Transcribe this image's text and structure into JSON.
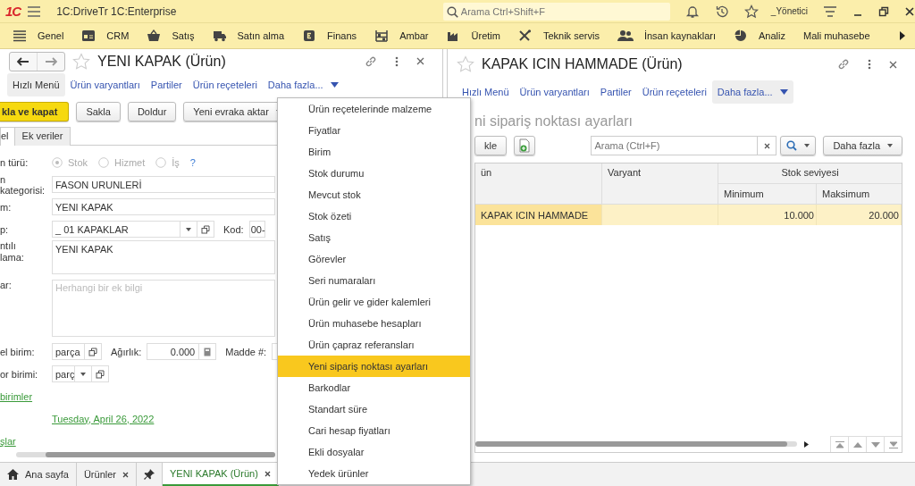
{
  "app": {
    "logo": "1C",
    "title": "1C:DriveTr 1C:Enterprise",
    "search_placeholder": "Arama Ctrl+Shift+F",
    "user": "_Yönetici"
  },
  "sections": [
    {
      "label": "Genel"
    },
    {
      "label": "CRM"
    },
    {
      "label": "Satış"
    },
    {
      "label": "Satın alma"
    },
    {
      "label": "Finans"
    },
    {
      "label": "Ambar"
    },
    {
      "label": "Üretim"
    },
    {
      "label": "Teknik servis"
    },
    {
      "label": "İnsan kaynakları"
    },
    {
      "label": "Analiz"
    },
    {
      "label": "Mali muhasebe"
    }
  ],
  "left_form": {
    "title": "YENI KAPAK (Ürün)",
    "nav": [
      {
        "label": "Hızlı Menü",
        "kind": "link",
        "selected": true
      },
      {
        "label": "Ürün varyantları",
        "kind": "link",
        "selected": false
      },
      {
        "label": "Partiler",
        "kind": "link",
        "selected": false
      },
      {
        "label": "Ürün reçeteleri",
        "kind": "link",
        "selected": false
      },
      {
        "label": "Daha fazla...",
        "kind": "more",
        "selected": false
      }
    ],
    "buttons": [
      {
        "label": "kla ve kapat",
        "kind": "primary"
      },
      {
        "label": "Sakla",
        "kind": "plain"
      },
      {
        "label": "Doldur",
        "kind": "plain"
      },
      {
        "label": "Yeni evraka aktar",
        "kind": "dropdown"
      }
    ],
    "tabs": [
      {
        "label": "el",
        "selected": true
      },
      {
        "label": "Ek veriler",
        "selected": false
      }
    ],
    "item_type": {
      "label": "n türü:",
      "help": "?",
      "options": [
        {
          "label": "Stok",
          "selected": true,
          "disabled": true
        },
        {
          "label": "Hizmet",
          "selected": false,
          "disabled": true
        },
        {
          "label": "İş",
          "selected": false,
          "disabled": true
        }
      ]
    },
    "category": {
      "label": "n kategorisi:",
      "value": "FASON URUNLERİ"
    },
    "name": {
      "label": "m:",
      "value": "YENI KAPAK"
    },
    "group": {
      "label": "p:",
      "value": "_ 01 KAPAKLAR",
      "code_label": "Kod:",
      "code_value": "00-"
    },
    "description": {
      "label": "ntılı\nlama:",
      "value": "YENI KAPAK"
    },
    "notes": {
      "label": "ar:",
      "placeholder": "Herhangi bir ek bilgi"
    },
    "unit": {
      "label": "el birim:",
      "value": "parça",
      "weight_label": "Ağırlık:",
      "weight_value": "0.000",
      "item_no_label": "Madde #:"
    },
    "report_unit": {
      "label": "or birimi:",
      "value": "parç"
    },
    "units_link": "birimler",
    "date_link": "Tuesday, April 26, 2022",
    "last_link": "şlar"
  },
  "menu": [
    {
      "label": "Ürün reçetelerinde malzeme",
      "selected": false
    },
    {
      "label": "Fiyatlar",
      "selected": false
    },
    {
      "label": "Birim",
      "selected": false
    },
    {
      "label": "Stok durumu",
      "selected": false
    },
    {
      "label": "Mevcut stok",
      "selected": false
    },
    {
      "label": "Stok özeti",
      "selected": false
    },
    {
      "label": "Satış",
      "selected": false
    },
    {
      "label": "Görevler",
      "selected": false
    },
    {
      "label": "Seri numaraları",
      "selected": false
    },
    {
      "label": "Ürün gelir ve gider kalemleri",
      "selected": false
    },
    {
      "label": "Ürün muhasebe hesapları",
      "selected": false
    },
    {
      "label": "Ürün çapraz referansları",
      "selected": false
    },
    {
      "label": "Yeni sipariş noktası ayarları",
      "selected": true
    },
    {
      "label": "Barkodlar",
      "selected": false
    },
    {
      "label": "Standart süre",
      "selected": false
    },
    {
      "label": "Cari hesap fiyatları",
      "selected": false
    },
    {
      "label": "Ekli dosyalar",
      "selected": false
    },
    {
      "label": "Yedek ürünler",
      "selected": false
    }
  ],
  "right_form": {
    "title": "KAPAK ICIN HAMMADE (Ürün)",
    "nav": [
      {
        "label": "Hızlı Menü",
        "kind": "link",
        "selected": false
      },
      {
        "label": "Ürün varyantları",
        "kind": "link",
        "selected": false
      },
      {
        "label": "Partiler",
        "kind": "link",
        "selected": false
      },
      {
        "label": "Ürün reçeteleri",
        "kind": "link",
        "selected": false
      },
      {
        "label": "Daha fazla...",
        "kind": "more",
        "selected": true
      }
    ],
    "section_title": "ni sipariş noktası ayarları",
    "add_button": "kle",
    "search_placeholder": "Arama (Ctrl+F)",
    "more_button": "Daha fazla",
    "table": {
      "columns": [
        "ün",
        "Varyant"
      ],
      "group_column": "Stok seviyesi",
      "sub_columns": [
        "Minimum",
        "Maksimum"
      ],
      "rows": [
        {
          "product": "KAPAK ICIN HAMMADE",
          "minimum": "10.000",
          "maximum": "20.000",
          "selected": true
        }
      ]
    }
  },
  "open_tabs": [
    {
      "kind": "home",
      "label": "Ana sayfa",
      "closable": false,
      "selected": false
    },
    {
      "kind": "page",
      "label": "Ürünler",
      "closable": true,
      "selected": false
    },
    {
      "kind": "pin",
      "closable": false,
      "selected": false
    },
    {
      "kind": "page",
      "label": "YENI KAPAK (Ürün)",
      "closable": true,
      "selected": true
    }
  ]
}
